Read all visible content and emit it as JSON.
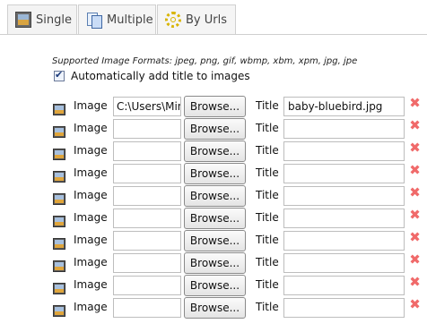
{
  "tabs": [
    {
      "label": "Single",
      "icon": "image-icon"
    },
    {
      "label": "Multiple",
      "icon": "multiple-documents-icon"
    },
    {
      "label": "By Urls",
      "icon": "gear-icon"
    }
  ],
  "formats_text": "Supported Image Formats: jpeg, png, gif, wbmp, xbm, xpm, jpg, jpe",
  "auto_title": {
    "label": "Automatically add title to images",
    "checked": true
  },
  "row_labels": {
    "image": "Image",
    "browse": "Browse...",
    "title": "Title"
  },
  "rows": [
    {
      "file": "C:\\Users\\Min",
      "title": "baby-bluebird.jpg"
    },
    {
      "file": "",
      "title": ""
    },
    {
      "file": "",
      "title": ""
    },
    {
      "file": "",
      "title": ""
    },
    {
      "file": "",
      "title": ""
    },
    {
      "file": "",
      "title": ""
    },
    {
      "file": "",
      "title": ""
    },
    {
      "file": "",
      "title": ""
    },
    {
      "file": "",
      "title": ""
    },
    {
      "file": "",
      "title": ""
    }
  ],
  "colors": {
    "remove": "#f06a6a",
    "tab_border": "#d0d0d0"
  }
}
